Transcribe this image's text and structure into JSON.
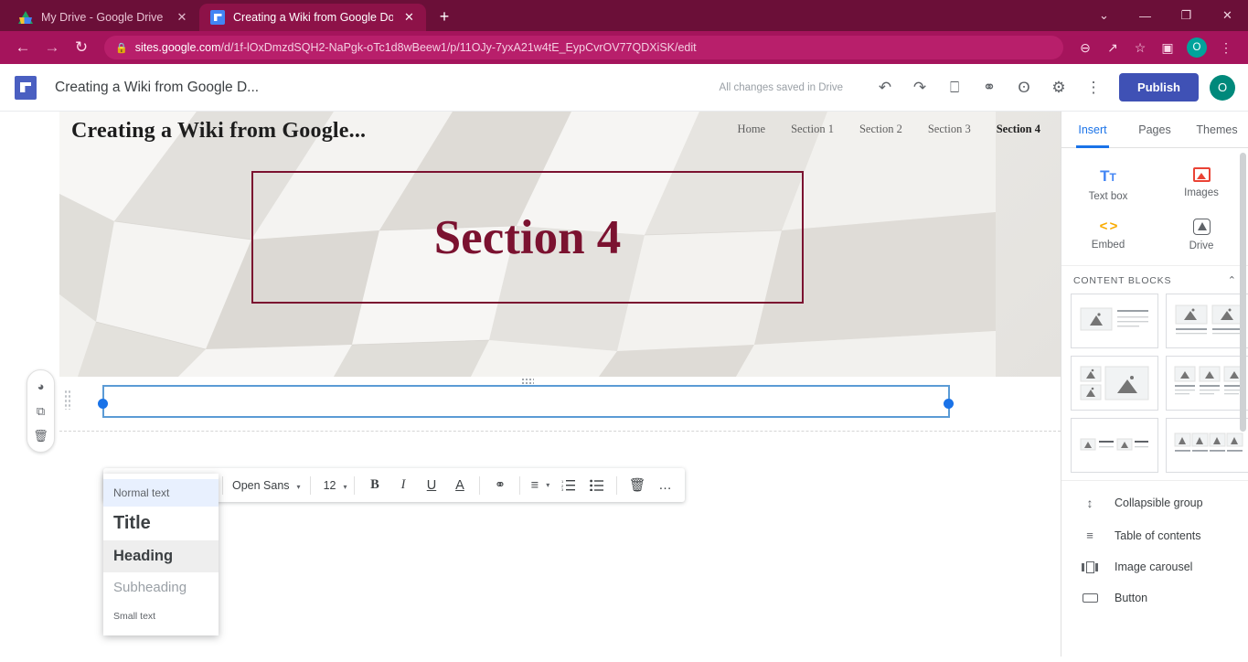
{
  "browser": {
    "tabs": [
      {
        "title": "My Drive - Google Drive",
        "favicon": "drive-icon",
        "active": false,
        "close_label": "✕"
      },
      {
        "title": "Creating a Wiki from Google Doc",
        "favicon": "sites-icon",
        "active": true,
        "close_label": "✕"
      }
    ],
    "new_tab_label": "+",
    "window_controls": {
      "chevron": "⌄",
      "minimize": "—",
      "maximize": "❐",
      "close": "✕"
    },
    "nav": {
      "back": "←",
      "forward": "→",
      "reload": "↻"
    },
    "omnibox": {
      "lock": "🔒",
      "url_domain": "sites.google.com",
      "url_path": "/d/1f-lOxDmzdSQH2-NaPgk-oTc1d8wBeew1/p/11OJy-7yxA21w4tE_EypCvrOV77QDXiSK/edit"
    },
    "toolbar_icons": {
      "zoom_out": "⊖",
      "share": "↗",
      "bookmark": "☆",
      "side_panel": "▣",
      "profile_initial": "O",
      "menu": "⋮"
    }
  },
  "app_header": {
    "logo": "sites-logo-icon",
    "doc_title": "Creating a Wiki from Google D...",
    "save_status": "All changes saved in Drive",
    "icons": {
      "undo": "↶",
      "redo": "↷",
      "preview": "⎕",
      "copy_link": "⚭",
      "share_with_others": "ʘ",
      "settings": "⚙",
      "more": "⋮"
    },
    "publish_label": "Publish",
    "avatar_initial": "O"
  },
  "site": {
    "banner_title": "Creating a Wiki from Google...",
    "nav_items": [
      {
        "label": "Home",
        "active": false
      },
      {
        "label": "Section 1",
        "active": false
      },
      {
        "label": "Section 2",
        "active": false
      },
      {
        "label": "Section 3",
        "active": false
      },
      {
        "label": "Section 4",
        "active": true
      }
    ],
    "section_heading": "Section 4",
    "accent_color": "#7b1230"
  },
  "left_tools": {
    "theme": "◑",
    "duplicate": "⧉",
    "delete": "Ὕ1"
  },
  "format_toolbar": {
    "style_value": "Normal text",
    "font_value": "Open Sans",
    "size_value": "12",
    "caret": "▾",
    "bold": "B",
    "italic": "I",
    "underline": "U",
    "text_color": "A",
    "link": "⚭",
    "align": "≡",
    "numbered_list": "☰",
    "bulleted_list": "☰",
    "delete": "Ὕ1",
    "more": "…"
  },
  "style_menu": {
    "items": [
      {
        "label": "Normal text",
        "state": "selected"
      },
      {
        "label": "Title",
        "state": "default"
      },
      {
        "label": "Heading",
        "state": "hover"
      },
      {
        "label": "Subheading",
        "state": "default"
      },
      {
        "label": "Small text",
        "state": "default"
      }
    ]
  },
  "right_panel": {
    "tabs": [
      {
        "label": "Insert",
        "active": true
      },
      {
        "label": "Pages",
        "active": false
      },
      {
        "label": "Themes",
        "active": false
      }
    ],
    "insert_items": [
      {
        "label": "Text box",
        "icon": "text-box-icon"
      },
      {
        "label": "Images",
        "icon": "images-icon"
      },
      {
        "label": "Embed",
        "icon": "embed-icon"
      },
      {
        "label": "Drive",
        "icon": "drive-icon"
      }
    ],
    "content_blocks": {
      "title": "CONTENT BLOCKS",
      "collapse_icon": "⌃",
      "count": 6
    },
    "list_items": [
      {
        "label": "Collapsible group",
        "icon": "collapsible-group-icon"
      },
      {
        "label": "Table of contents",
        "icon": "table-of-contents-icon"
      },
      {
        "label": "Image carousel",
        "icon": "image-carousel-icon"
      },
      {
        "label": "Button",
        "icon": "button-icon"
      }
    ]
  }
}
